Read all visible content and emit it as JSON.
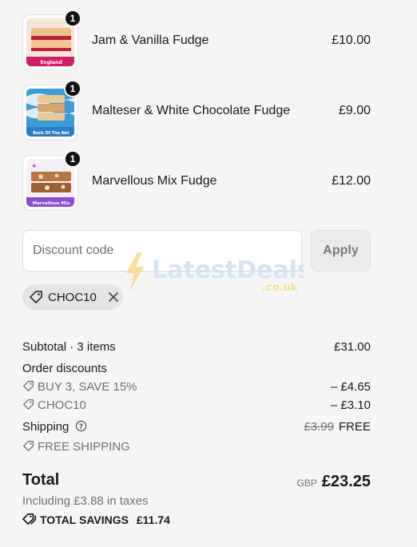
{
  "cart": {
    "items": [
      {
        "name": "Jam & Vanilla Fudge",
        "price": "£10.00",
        "quantity": "1",
        "thumb_label": "England"
      },
      {
        "name": "Malteser & White Chocolate Fudge",
        "price": "£9.00",
        "quantity": "1",
        "thumb_label": "Back Of The Net"
      },
      {
        "name": "Marvellous Mix Fudge",
        "price": "£12.00",
        "quantity": "1",
        "thumb_label": "Marvellous Mix"
      }
    ]
  },
  "discount": {
    "placeholder": "Discount code",
    "apply_label": "Apply",
    "applied_code": "CHOC10"
  },
  "watermark": {
    "brand": "LatestDeals",
    "suffix": ".co.uk"
  },
  "summary": {
    "subtotal_label": "Subtotal · 3 items",
    "subtotal_value": "£31.00",
    "order_discounts_label": "Order discounts",
    "discount_1_label": "BUY 3, SAVE 15%",
    "discount_1_value": "– £4.65",
    "discount_2_label": "CHOC10",
    "discount_2_value": "– £3.10",
    "shipping_label": "Shipping",
    "shipping_original": "£3.99",
    "shipping_value": "FREE",
    "shipping_discount_label": "FREE SHIPPING",
    "total_label": "Total",
    "currency": "GBP",
    "total_value": "£23.25",
    "taxes_note": "Including £3.88 in taxes",
    "total_savings_label": "TOTAL SAVINGS",
    "total_savings_value": "£11.74"
  },
  "colors": {
    "background": "#f5f5f5",
    "text": "#1a1a1a",
    "muted": "#707070",
    "badge": "#111111"
  }
}
